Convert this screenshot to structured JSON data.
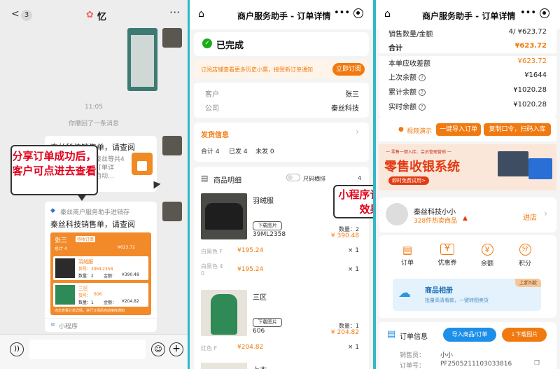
{
  "chat": {
    "back": "3",
    "title": "忆",
    "time": "11:05",
    "recall": "你撤回了一条消息",
    "msg_title": "秦丝科技销售单，请查阅",
    "msg_line1": "秦丝等共4",
    "msg_line2": "订单详",
    "msg_line3": "自动…",
    "tip": "分享订单成功后，客户可点进去查看",
    "mini_source": "秦丝商户服务助手进销存",
    "mini_title": "秦丝科技销售单，请查阅",
    "mini_label": "小程序",
    "thumb": {
      "header": "张三",
      "tag": "待收订单",
      "row1": "总计 4",
      "row2": "¥623.72",
      "item1": "羽绒服",
      "item1_no": "货号：39ML2358",
      "item1_qty": "数量：2",
      "item1_amt": "金额：",
      "item1_price": "¥390.48",
      "item2": "三区",
      "item2_no": "货号：",
      "item2_code": "606",
      "item2_qty": "数量：1",
      "item2_amt": "金额：",
      "item2_price": "¥204.82",
      "footer": "点击查看订单详情，进行订阅后自动接收通知"
    }
  },
  "order": {
    "title": "商户服务助手 - 订单详情",
    "status": "已完成",
    "notice": "订阅店铺查看更多历史小票，接受新订单通知",
    "subscribe": "立即订阅",
    "customer_label": "客户",
    "customer": "张三",
    "company_label": "公司",
    "company": "秦丝科技",
    "ship_title": "发货信息",
    "ship_total": "合计 4",
    "ship_sent": "已发 4",
    "ship_unsent": "未发 0",
    "detail_title": "商品明细",
    "size_toggle": "尺码横排",
    "size_count": "4",
    "items": [
      {
        "name": "羽绒服",
        "download": "下载图片",
        "code": "39ML2358",
        "qty": "数量：2",
        "total": "¥ 390.48",
        "variants": [
          {
            "label": "白黑色 F",
            "price": "¥195.24",
            "qty": "× 1"
          },
          {
            "label": "白黑色 4\n0",
            "price": "¥195.24",
            "qty": "× 1"
          }
        ]
      },
      {
        "name": "三区",
        "download": "下载图片",
        "code": "606",
        "qty": "数量：1",
        "total": "¥ 204.82",
        "variants": [
          {
            "label": "红色 F",
            "price": "¥204.82",
            "qty": "× 1"
          }
        ]
      }
    ],
    "next_item": "上衣",
    "tip": "小程序订单查看效果图"
  },
  "detail": {
    "title": "商户服务助手 - 订单详情",
    "rows": [
      {
        "label": "销售数量/金额",
        "value": "4/ ¥623.72"
      },
      {
        "label": "合计",
        "value": "¥623.72"
      },
      {
        "label": "本单应收差额",
        "value": "¥623.72"
      },
      {
        "label": "上次余额",
        "value": "¥1644"
      },
      {
        "label": "累计余额",
        "value": "¥1020.28"
      },
      {
        "label": "实时余额",
        "value": "¥1020.28"
      }
    ],
    "video": "视频演示",
    "import_btn": "一键导入订单",
    "copy_btn": "复制口令，扫码入库",
    "banner_small": "一 零售一键入库、会员管理营销 一",
    "banner_big": "零售收银系统",
    "banner_cta": "即时免费试用>",
    "shop_name": "秦丝科技小小",
    "shop_hot": "328件热卖商品",
    "shop_enter": "进店",
    "menu": [
      {
        "label": "订单",
        "icon": "doc-icon"
      },
      {
        "label": "优惠券",
        "icon": "coupon-icon"
      },
      {
        "label": "余额",
        "icon": "yen-icon"
      },
      {
        "label": "积分",
        "icon": "points-icon"
      }
    ],
    "album_title": "商品相册",
    "album_sub": "批量高清看款，一键转图卖货",
    "album_badge": "上新5款",
    "order_info": "订单信息",
    "import_goods": "导入商品/订单",
    "download_img": "下载图片",
    "seller_label": "销售员：",
    "seller": "小小",
    "order_no_label": "订单号：",
    "order_no": "PF2505211103033816",
    "colors": {
      "orange": "#f07a10",
      "red": "#e1001c",
      "blue": "#1e8fe8"
    }
  }
}
